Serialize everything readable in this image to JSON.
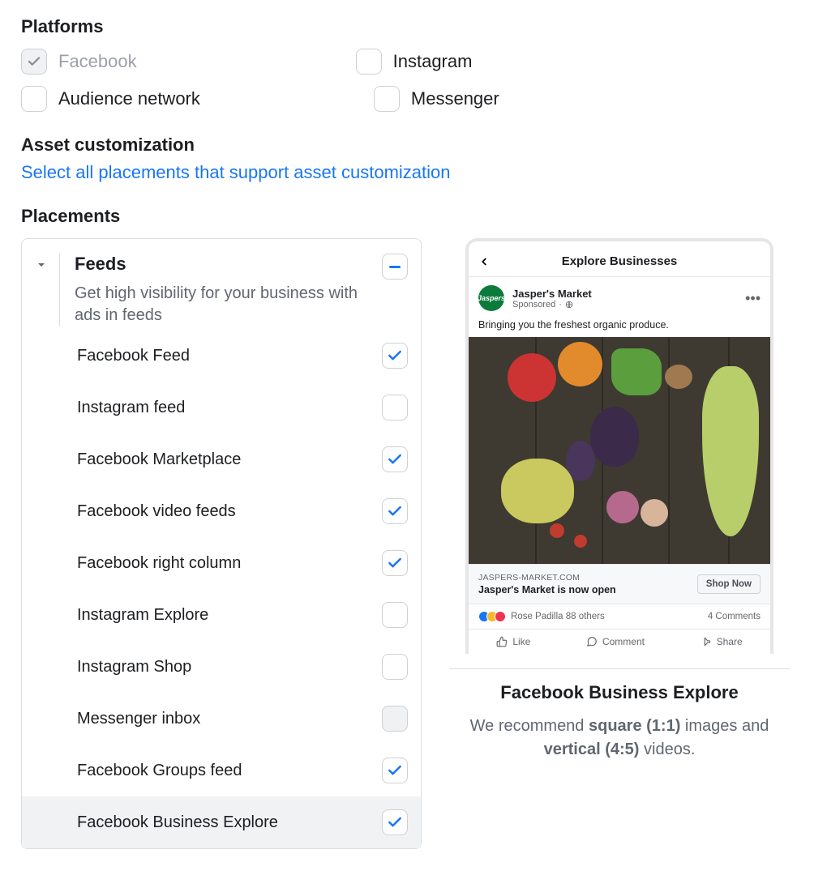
{
  "headings": {
    "platforms": "Platforms",
    "asset_custom": "Asset customization",
    "placements": "Placements"
  },
  "platforms": {
    "facebook": "Facebook",
    "instagram": "Instagram",
    "audience_network": "Audience network",
    "messenger": "Messenger"
  },
  "asset_link": "Select all placements that support asset customization",
  "feeds": {
    "title": "Feeds",
    "desc": "Get high visibility for your business with ads in feeds",
    "items": [
      {
        "label": "Facebook Feed",
        "checked": true
      },
      {
        "label": "Instagram feed",
        "checked": false
      },
      {
        "label": "Facebook Marketplace",
        "checked": true
      },
      {
        "label": "Facebook video feeds",
        "checked": true
      },
      {
        "label": "Facebook right column",
        "checked": true
      },
      {
        "label": "Instagram Explore",
        "checked": false
      },
      {
        "label": "Instagram Shop",
        "checked": false
      },
      {
        "label": "Messenger inbox",
        "checked": false,
        "disabled": true
      },
      {
        "label": "Facebook Groups feed",
        "checked": true
      },
      {
        "label": "Facebook Business Explore",
        "checked": true,
        "selected": true
      }
    ]
  },
  "preview": {
    "nav_title": "Explore Businesses",
    "page_name": "Jasper's Market",
    "sponsored": "Sponsored",
    "avatar_text": "Jaspers",
    "body": "Bringing you the freshest organic produce.",
    "domain": "JASPERS-MARKET.COM",
    "headline": "Jasper's Market is now open",
    "cta": "Shop Now",
    "social_text": "Rose Padilla 88 others",
    "comments": "4 Comments",
    "like": "Like",
    "comment": "Comment",
    "share": "Share",
    "title": "Facebook Business Explore",
    "rec_before": "We recommend ",
    "rec_b1": "square (1:1)",
    "rec_mid": " images and ",
    "rec_b2": "vertical (4:5)",
    "rec_after": " videos."
  }
}
